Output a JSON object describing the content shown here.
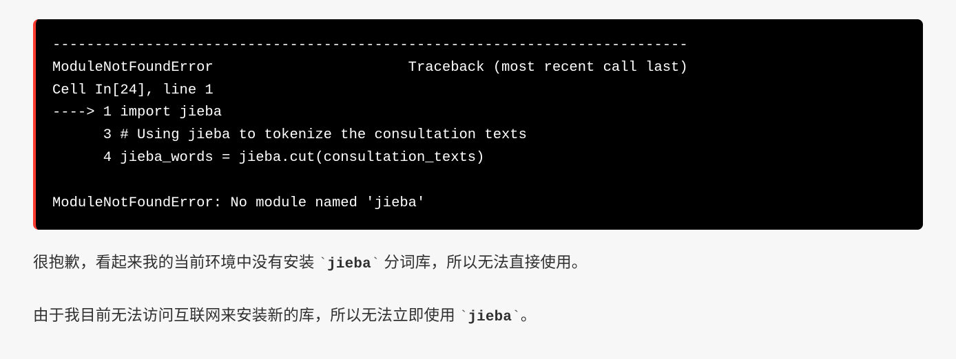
{
  "traceback": {
    "dashes": "---------------------------------------------------------------------------",
    "header": "ModuleNotFoundError                       Traceback (most recent call last)",
    "cell": "Cell In[24], line 1",
    "arrow_line": "----> 1 import jieba",
    "line3": "      3 # Using jieba to tokenize the consultation texts",
    "line4": "      4 jieba_words = jieba.cut(consultation_texts)",
    "final": "ModuleNotFoundError: No module named 'jieba'"
  },
  "prose": {
    "p1_before": "很抱歉，看起来我的当前环境中没有安装 ",
    "p1_code": "jieba",
    "p1_after": " 分词库，所以无法直接使用。",
    "p2_before": "由于我目前无法访问互联网来安装新的库，所以无法立即使用 ",
    "p2_code": "jieba",
    "p2_after": "。",
    "tick": "`"
  }
}
